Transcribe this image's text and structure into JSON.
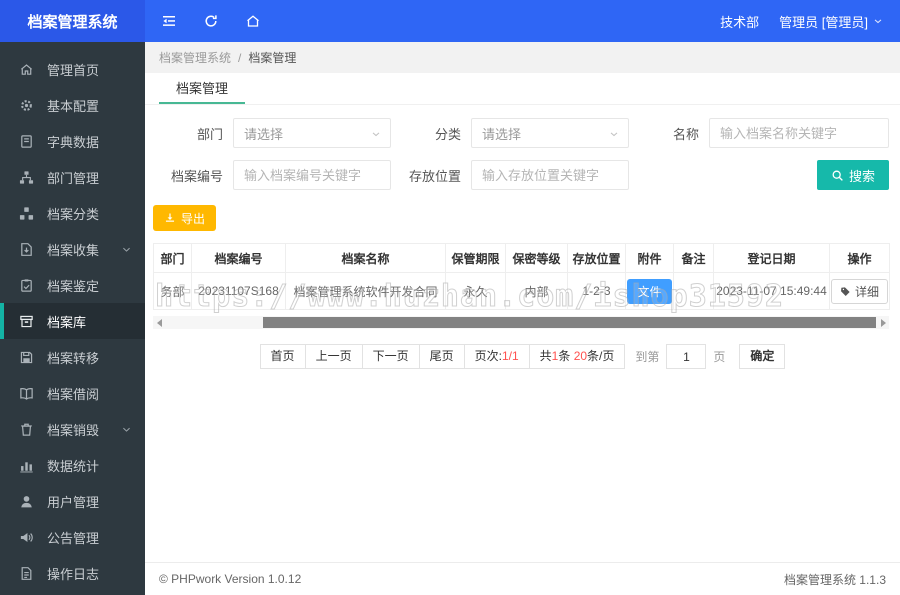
{
  "header": {
    "title": "档案管理系统",
    "department": "技术部",
    "user": "管理员 [管理员]"
  },
  "sidebar": {
    "items": [
      {
        "label": "管理首页",
        "icon": "home"
      },
      {
        "label": "基本配置",
        "icon": "gear"
      },
      {
        "label": "字典数据",
        "icon": "dict"
      },
      {
        "label": "部门管理",
        "icon": "sitemap"
      },
      {
        "label": "档案分类",
        "icon": "category"
      },
      {
        "label": "档案收集",
        "icon": "collect",
        "expandable": true
      },
      {
        "label": "档案鉴定",
        "icon": "appraise"
      },
      {
        "label": "档案库",
        "icon": "archive",
        "active": true
      },
      {
        "label": "档案转移",
        "icon": "transfer"
      },
      {
        "label": "档案借阅",
        "icon": "borrow"
      },
      {
        "label": "档案销毁",
        "icon": "destroy",
        "expandable": true
      },
      {
        "label": "数据统计",
        "icon": "stats"
      },
      {
        "label": "用户管理",
        "icon": "user"
      },
      {
        "label": "公告管理",
        "icon": "announce"
      },
      {
        "label": "操作日志",
        "icon": "log"
      }
    ]
  },
  "breadcrumb": {
    "root": "档案管理系统",
    "separator": "/",
    "current": "档案管理"
  },
  "tab": {
    "label": "档案管理"
  },
  "filters": {
    "dept_label": "部门",
    "dept_placeholder": "请选择",
    "category_label": "分类",
    "category_placeholder": "请选择",
    "name_label": "名称",
    "name_placeholder": "输入档案名称关键字",
    "code_label": "档案编号",
    "code_placeholder": "输入档案编号关键字",
    "location_label": "存放位置",
    "location_placeholder": "输入存放位置关键字",
    "search_label": "搜索"
  },
  "toolbar": {
    "export_label": "导出"
  },
  "table": {
    "columns": [
      "部门",
      "档案编号",
      "档案名称",
      "保管期限",
      "保密等级",
      "存放位置",
      "附件",
      "备注",
      "登记日期",
      "操作"
    ],
    "rows": [
      {
        "dept": "务部",
        "code": "20231107S168",
        "name": "档案管理系统软件开发合同",
        "term": "永久",
        "secrecy": "内部",
        "location": "1-2-3",
        "attachment": "文件",
        "note": "",
        "date": "2023-11-07 15:49:44",
        "action": "详细"
      }
    ]
  },
  "pagination": {
    "first": "首页",
    "prev": "上一页",
    "next": "下一页",
    "last": "尾页",
    "page_label": "页次:",
    "page_value": "1/1",
    "total_prefix": "共",
    "total_count": "1",
    "total_mid": "条 ",
    "per_page": "20",
    "per_page_suffix": "条/页",
    "goto_label": "到第",
    "goto_value": "1",
    "goto_unit": "页",
    "confirm": "确定"
  },
  "footer": {
    "left": "© PHPwork Version 1.0.12",
    "right": "档案管理系统 1.1.3"
  },
  "watermark": "https://www.huzhan.com/ishop31592",
  "colors": {
    "header_blue": "#2f66f5",
    "logo_blue": "#2b58e8",
    "sidebar_bg": "#2e3940",
    "accent_teal": "#16b9aa",
    "tab_underline": "#47b894",
    "export_orange": "#ffb800",
    "attachment_blue": "#409eff",
    "pager_red": "#ff5250"
  }
}
